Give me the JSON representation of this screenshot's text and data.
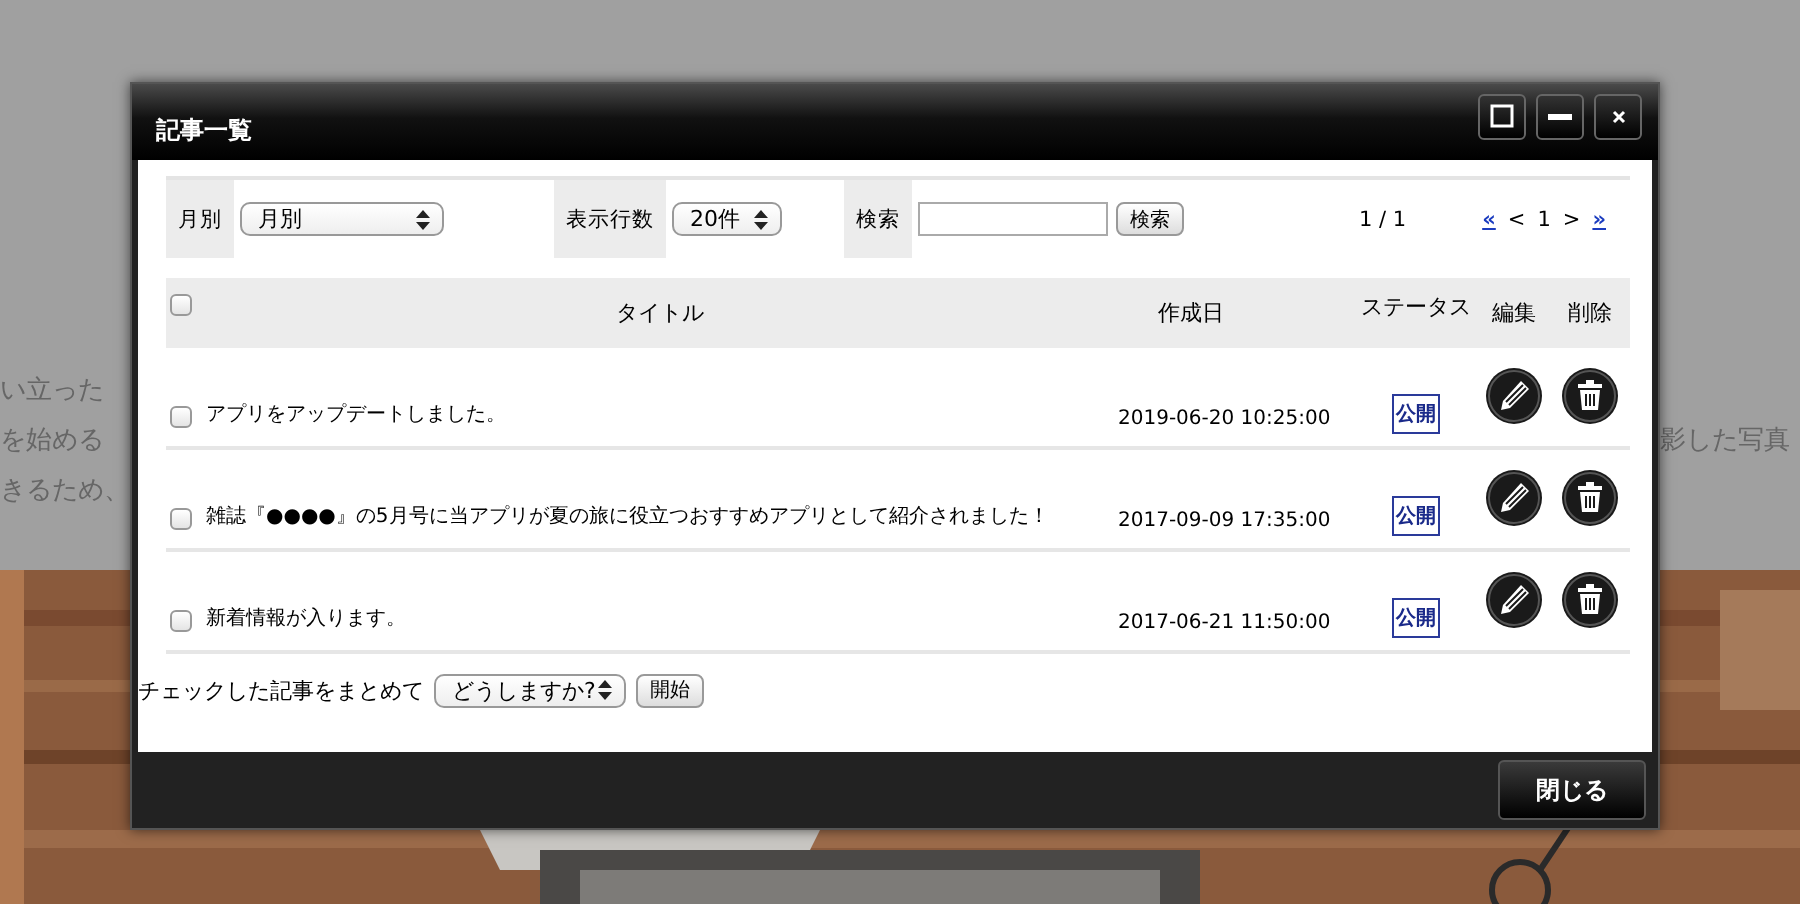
{
  "background": {
    "left_lines": [
      "い立った",
      "を始める",
      "きるため、"
    ],
    "right_text": "影した写真"
  },
  "window": {
    "title": "記事一覧"
  },
  "filters": {
    "month": {
      "label": "月別",
      "value": "月別"
    },
    "rows": {
      "label": "表示行数",
      "value": "20件"
    },
    "search": {
      "label": "検索",
      "button": "検索"
    }
  },
  "pagination": {
    "summary": "1 / 1",
    "first": "«",
    "prev": "<",
    "current": "1",
    "next": ">",
    "last": "»"
  },
  "table": {
    "select_all": {
      "checked": false
    },
    "columns": [
      "タイトル",
      "作成日",
      "ステータス",
      "編集",
      "削除"
    ],
    "rows": [
      {
        "checked": false,
        "title": "アプリをアップデートしました。",
        "created": "2019-06-20 10:25:00",
        "status": "公開"
      },
      {
        "checked": false,
        "title": "雑誌『●●●●』の5月号に当アプリが夏の旅に役立つおすすめアプリとして紹介されました！",
        "created": "2017-09-09 17:35:00",
        "status": "公開"
      },
      {
        "checked": false,
        "title": "新着情報が入ります。",
        "created": "2017-06-21 11:50:00",
        "status": "公開"
      }
    ]
  },
  "bulk": {
    "label": "チェックした記事をまとめて",
    "action": "どうしますか?",
    "button": "開始"
  },
  "close_button": "閉じる"
}
